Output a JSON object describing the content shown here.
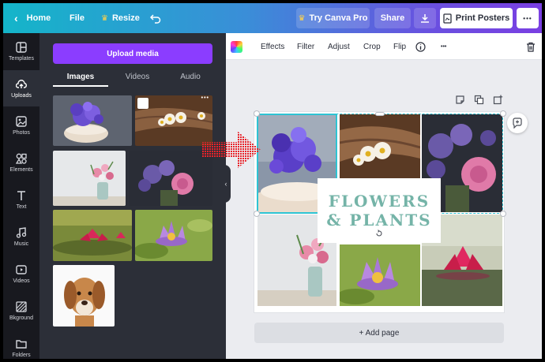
{
  "topbar": {
    "home_label": "Home",
    "file_label": "File",
    "resize_label": "Resize",
    "try_pro_label": "Try Canva Pro",
    "share_label": "Share",
    "print_label": "Print Posters",
    "more_label": "•••"
  },
  "rail": {
    "items": [
      {
        "label": "Templates"
      },
      {
        "label": "Uploads"
      },
      {
        "label": "Photos"
      },
      {
        "label": "Elements"
      },
      {
        "label": "Text"
      },
      {
        "label": "Music"
      },
      {
        "label": "Videos"
      },
      {
        "label": "Bkground"
      },
      {
        "label": "Folders"
      }
    ]
  },
  "uploads": {
    "upload_button": "Upload media",
    "tabs": [
      {
        "label": "Images"
      },
      {
        "label": "Videos"
      },
      {
        "label": "Audio"
      }
    ],
    "thumb_more": "•••"
  },
  "editor_toolbar": {
    "effects": "Effects",
    "filter": "Filter",
    "adjust": "Adjust",
    "crop": "Crop",
    "flip": "Flip",
    "more": "•••"
  },
  "canvas": {
    "title_line1": "FLOWERS",
    "title_line2": "& PLANTS",
    "add_page": "+ Add page"
  },
  "colors": {
    "accent_purple": "#8b3dff",
    "selection_teal": "#2ec4d4",
    "title_teal": "#75b4a8",
    "arrow_red": "#e8232a"
  }
}
